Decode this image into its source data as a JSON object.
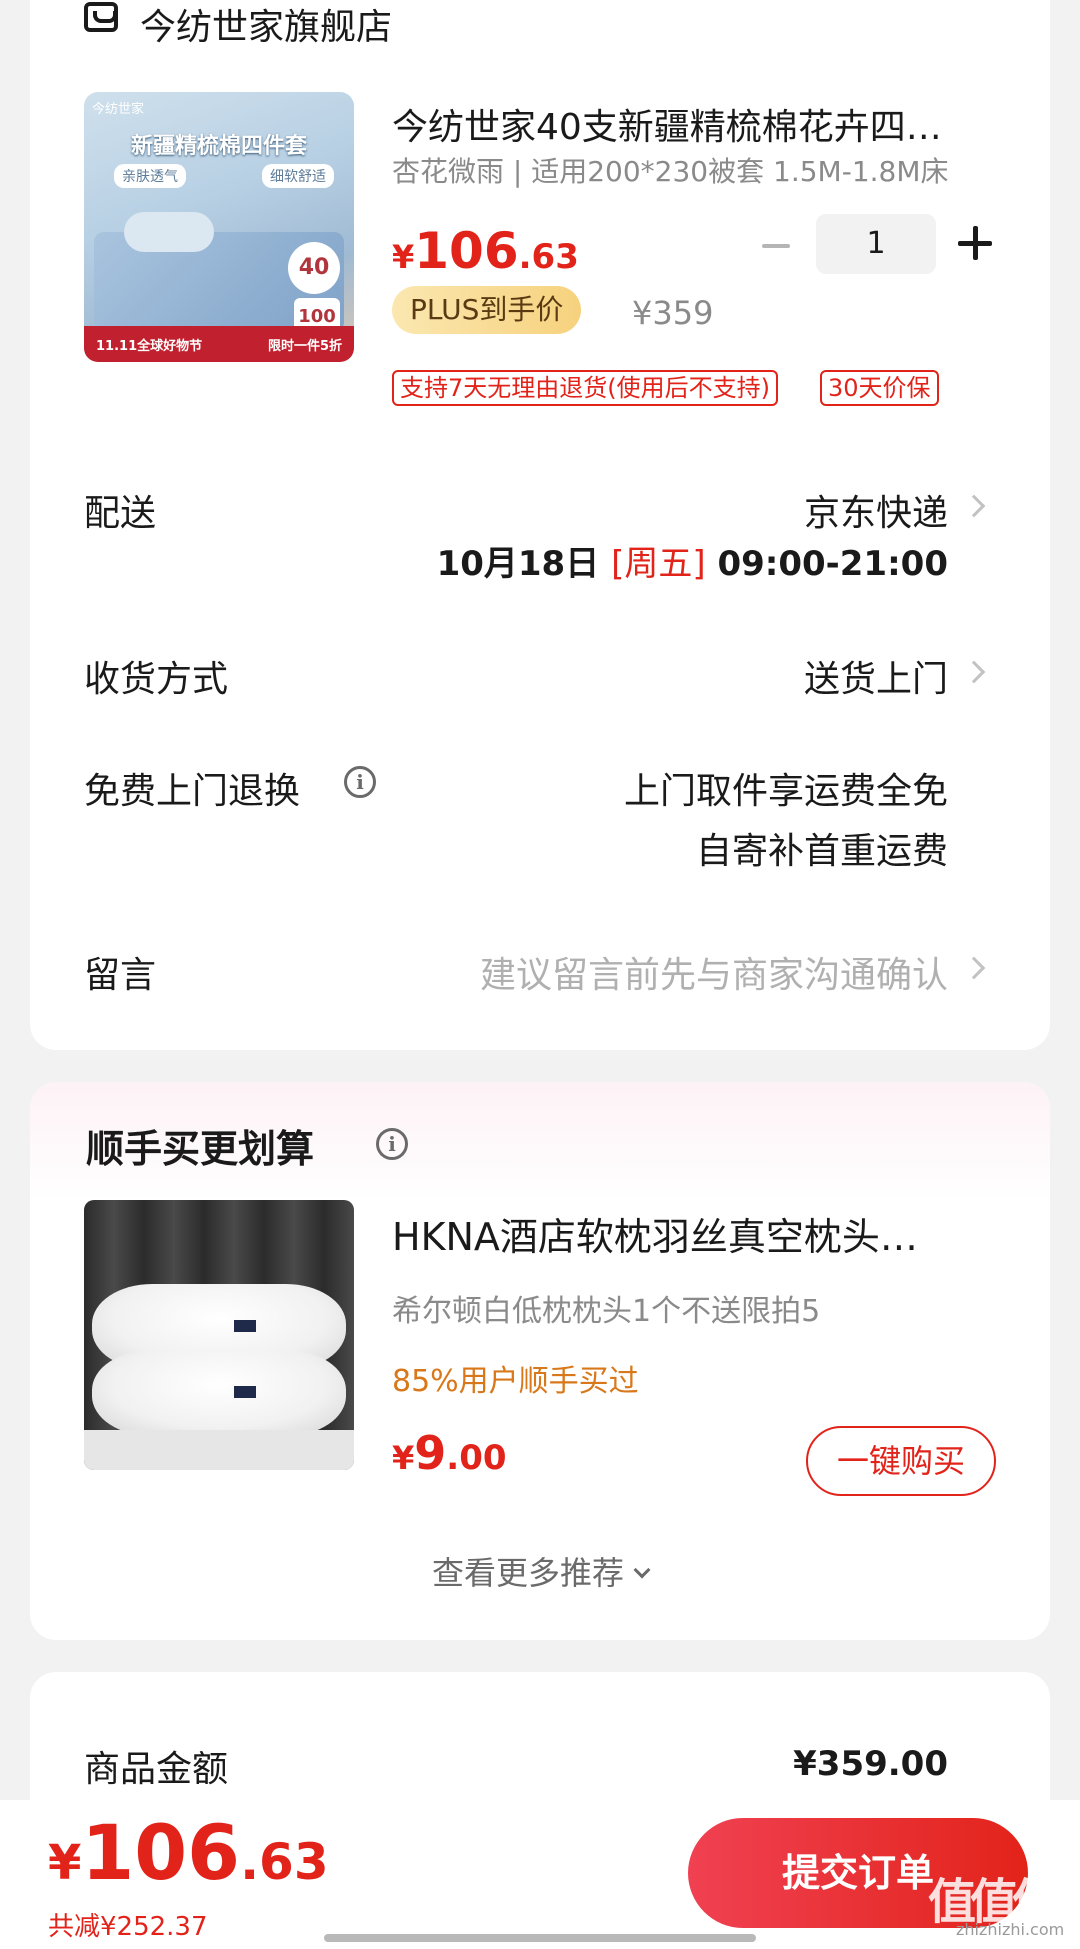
{
  "store": {
    "name": "今纺世家旗舰店",
    "icon": "store-icon"
  },
  "product": {
    "title": "今纺世家40支新疆精梳棉花卉四…",
    "spec": "杏花微雨 | 适用200*230被套 1.5M-1.8M床",
    "image": {
      "brand": "今纺世家",
      "banner": "新疆精梳棉四件套",
      "tag1": "亲肤透气",
      "tag2": "细软舒适",
      "badge1": "40",
      "badge2": "100",
      "foot_left": "11.11全球好物节",
      "foot_right": "限时一件5折"
    },
    "price_symbol": "¥",
    "price_int": "106",
    "price_dec": ".63",
    "plus_label": "PLUS到手价",
    "original_price": "¥359",
    "quantity": "1",
    "service_tags": [
      "支持7天无理由退货(使用后不支持)",
      "30天价保"
    ]
  },
  "delivery": {
    "label": "配送",
    "value": "京东快递",
    "date": "10月18日",
    "weekday": "[周五]",
    "time": "09:00-21:00"
  },
  "receive": {
    "label": "收货方式",
    "value": "送货上门"
  },
  "return_service": {
    "label": "免费上门退换",
    "line1": "上门取件享运费全免",
    "line2": "自寄补首重运费"
  },
  "message": {
    "label": "留言",
    "placeholder": "建议留言前先与商家沟通确认"
  },
  "recommend": {
    "title": "顺手买更划算",
    "item_name": "HKNA酒店软枕羽丝真空枕头…",
    "item_sub": "希尔顿白低枕枕头1个不送限拍5",
    "item_pct": "85%用户顺手买过",
    "price_symbol": "¥",
    "price_int": "9",
    "price_dec": ".00",
    "buy_label": "一键购买",
    "more_label": "查看更多推荐"
  },
  "amount": {
    "label": "商品金额",
    "value": "¥359.00"
  },
  "footer": {
    "total_symbol": "¥",
    "total_int": "106",
    "total_dec": ".63",
    "saved": "共减¥252.37",
    "submit_label": "提交订单",
    "watermark": "值值值",
    "watermark_url": "zhizhizhi.com"
  },
  "colors": {
    "accent": "#e2231a",
    "plus_gold": "#f6d27e",
    "hint": "#b0b0b0"
  }
}
